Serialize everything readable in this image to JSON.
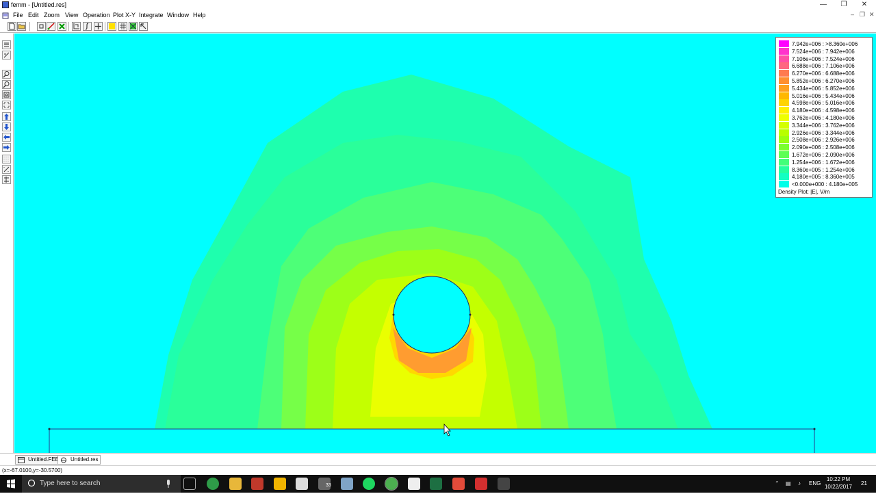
{
  "window": {
    "title": "femm - [Untitled.res]",
    "minimize": "—",
    "restore": "❐",
    "close": "✕",
    "mdi_minimize": "‒",
    "mdi_restore": "❐",
    "mdi_close": "✕"
  },
  "menu": {
    "items": [
      "File",
      "Edit",
      "Zoom",
      "View",
      "Operation",
      "Plot X-Y",
      "Integrate",
      "Window",
      "Help"
    ]
  },
  "toolbar": {
    "icons": [
      "new-file-icon",
      "open-file-icon",
      "point-mode-icon",
      "contour-icon",
      "clear-contour-icon",
      "zoom-window-icon",
      "integral-icon",
      "add-point-icon",
      "density-plot-icon",
      "vector-plot-icon",
      "mesh-icon",
      "pointer-icon"
    ]
  },
  "legend": {
    "colors": [
      "#ff00ff",
      "#ff33cc",
      "#ff4fa6",
      "#ff6680",
      "#ff7a50",
      "#ff8f30",
      "#ffa020",
      "#ffb800",
      "#ffd400",
      "#fff000",
      "#eeff00",
      "#d4ff00",
      "#b8ff00",
      "#9aff10",
      "#7aff30",
      "#5eff55",
      "#42ff7a",
      "#26ff9e",
      "#14ffc2",
      "#00ffe8",
      "#00ffff"
    ],
    "rows": [
      "7.942e+006 : >8.360e+006",
      "7.524e+006 : 7.942e+006",
      "7.106e+006 : 7.524e+006",
      "6.688e+006 : 7.106e+006",
      "6.270e+006 : 6.688e+006",
      "5.852e+006 : 6.270e+006",
      "5.434e+006 : 5.852e+006",
      "5.016e+006 : 5.434e+006",
      "4.598e+006 : 5.016e+006",
      "4.180e+006 : 4.598e+006",
      "3.762e+006 : 4.180e+006",
      "3.344e+006 : 3.762e+006",
      "2.926e+006 : 3.344e+006",
      "2.508e+006 : 2.926e+006",
      "2.090e+006 : 2.508e+006",
      "1.672e+006 : 2.090e+006",
      "1.254e+006 : 1.672e+006",
      "8.360e+005 : 1.254e+006",
      "4.180e+005 : 8.360e+005",
      "<0.000e+000 : 4.180e+005"
    ],
    "caption": "Density Plot: |E|, V/m"
  },
  "tabs": {
    "fee": "Untitled.FEE",
    "res": "Untitled.res"
  },
  "status": {
    "coords": "(x=-67.0100,y=-30.5700)"
  },
  "taskbar": {
    "search_placeholder": "Type here to search",
    "language": "ENG",
    "time": "10:22 PM",
    "date": "10/22/2017",
    "notifications": "21",
    "mail_badge": "33"
  }
}
